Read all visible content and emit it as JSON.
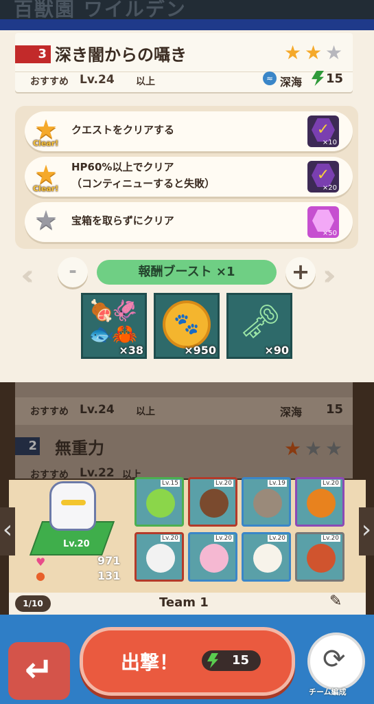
{
  "top_title": "百獣園 ワイルデン",
  "quest": {
    "number": "3",
    "title": "深き闇からの囁き",
    "stars_earned": 2,
    "stars_total": 3,
    "recommend_label": "おすすめ",
    "recommend_level": "Lv.24",
    "recommend_suffix": "以上",
    "area": "深海",
    "energy_cost": "15"
  },
  "missions": [
    {
      "text": "クエストをクリアする",
      "cleared": true,
      "clear_label": "Clear!",
      "reward_qty": "×10",
      "reward_icon": "check-medal-icon"
    },
    {
      "text_line1": "HP60%以上でクリア",
      "text_line2": "（コンティニューすると失敗）",
      "cleared": true,
      "clear_label": "Clear!",
      "reward_qty": "×20",
      "reward_icon": "check-medal-icon"
    },
    {
      "text": "宝箱を取らずにクリア",
      "cleared": false,
      "reward_qty": "×50",
      "reward_icon": "pink-gem-icon"
    }
  ],
  "boost": {
    "label": "報酬ブースト ×1",
    "minus": "-",
    "plus": "+"
  },
  "rewards": [
    {
      "icon": "food-bundle-icon",
      "qty": "×38"
    },
    {
      "icon": "paw-coin-icon",
      "qty": "×950"
    },
    {
      "icon": "sprout-key-icon",
      "qty": "×90"
    }
  ],
  "next_quest": {
    "row1_recommend": "おすすめ",
    "row1_level": "Lv.24",
    "row1_suffix": "以上",
    "row1_area": "深海",
    "row1_cost": "15",
    "number": "2",
    "title": "無重力",
    "row2_recommend": "おすすめ",
    "row2_level": "Lv.22",
    "row2_suffix": "以上"
  },
  "team": {
    "leader_level": "Lv.20",
    "hp": "971",
    "attack": "131",
    "page": "1/10",
    "name": "Team 1",
    "members": [
      {
        "lv": "Lv.15",
        "animal": "parrot",
        "color": "#4caf50",
        "face": "#8bd64a"
      },
      {
        "lv": "Lv.20",
        "animal": "bear",
        "color": "#b33a2a",
        "face": "#7a4a2e"
      },
      {
        "lv": "Lv.19",
        "animal": "sloth",
        "color": "#3a86c8",
        "face": "#9a8a7a"
      },
      {
        "lv": "Lv.20",
        "animal": "snake",
        "color": "#8c4ab6",
        "face": "#e8821e"
      },
      {
        "lv": "Lv.20",
        "animal": "zebra",
        "color": "#b33a2a",
        "face": "#f2f2f2"
      },
      {
        "lv": "Lv.20",
        "animal": "axolotl",
        "color": "#3a86c8",
        "face": "#f5b8d2"
      },
      {
        "lv": "Lv.20",
        "animal": "alpaca",
        "color": "#3a86c8",
        "face": "#f7f3ea"
      },
      {
        "lv": "Lv.20",
        "animal": "red-panda",
        "color": "#777777",
        "face": "#d0542e"
      }
    ]
  },
  "bottom": {
    "attack_label": "出撃！",
    "attack_cost": "15",
    "team_edit": "チーム編成"
  }
}
